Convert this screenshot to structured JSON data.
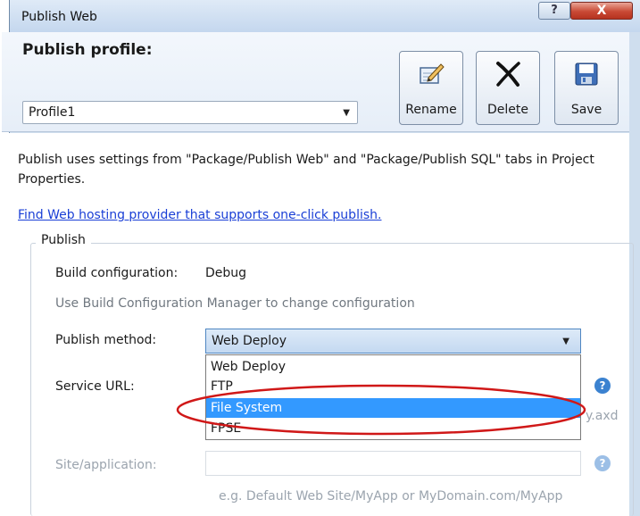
{
  "window": {
    "title": "Publish Web",
    "help_glyph": "?",
    "close_glyph": "X"
  },
  "header": {
    "profile_label": "Publish profile:",
    "profile_value": "Profile1",
    "rename_label": "Rename",
    "delete_label": "Delete",
    "save_label": "Save"
  },
  "content": {
    "description": "Publish uses settings from \"Package/Publish Web\" and \"Package/Publish SQL\" tabs in Project Properties.",
    "hosting_link": "Find Web hosting provider that supports one-click publish.",
    "group_label": "Publish",
    "build_config_label": "Build configuration:",
    "build_config_value": "Debug",
    "build_config_hint": "Use Build Configuration Manager to change configuration",
    "publish_method_label": "Publish method:",
    "publish_method_value": "Web Deploy",
    "method_options": [
      "Web Deploy",
      "FTP",
      "File System",
      "FPSE"
    ],
    "selected_option": "File System",
    "service_url_label": "Service URL:",
    "service_url_hint_fragment": "y.axd",
    "site_app_label": "Site/application:",
    "site_app_hint": "e.g. Default Web Site/MyApp or MyDomain.com/MyApp",
    "help_glyph": "?"
  },
  "colors": {
    "selection": "#3399ff",
    "annotation": "#d01818",
    "link": "#1a3fd6"
  },
  "icons": {
    "rename": "pencil-notepad-icon",
    "delete": "x-icon",
    "save": "floppy-disk-icon"
  }
}
